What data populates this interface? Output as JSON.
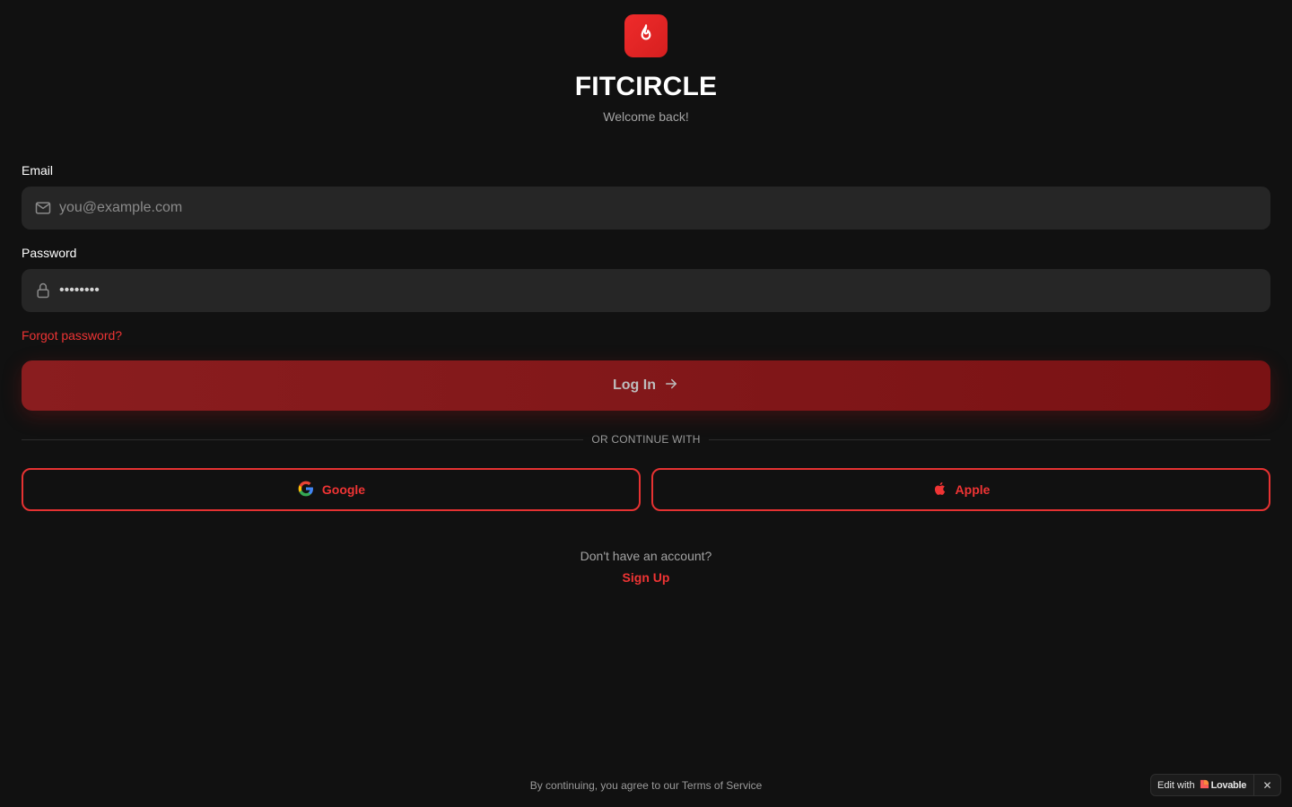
{
  "app": {
    "name": "FITCIRCLE",
    "subtitle": "Welcome back!"
  },
  "form": {
    "email_label": "Email",
    "email_placeholder": "you@example.com",
    "email_value": "",
    "password_label": "Password",
    "password_value": "••••••••",
    "forgot_link": "Forgot password?",
    "login_button": "Log In"
  },
  "divider": {
    "text": "OR CONTINUE WITH"
  },
  "social": {
    "google_label": "Google",
    "apple_label": "Apple"
  },
  "signup": {
    "prompt": "Don't have an account?",
    "link": "Sign Up"
  },
  "footer": {
    "terms": "By continuing, you agree to our Terms of Service"
  },
  "badge": {
    "edit_with": "Edit with",
    "brand": "Lovable",
    "close": "✕"
  },
  "icons": {
    "logo": "flame-icon",
    "email": "mail-icon",
    "password": "lock-icon",
    "login": "arrow-right-icon",
    "google": "google-icon",
    "apple": "apple-icon"
  },
  "colors": {
    "background": "#111111",
    "accent": "#ef3434",
    "login_button": "#8a1d1f",
    "field": "#262626"
  }
}
